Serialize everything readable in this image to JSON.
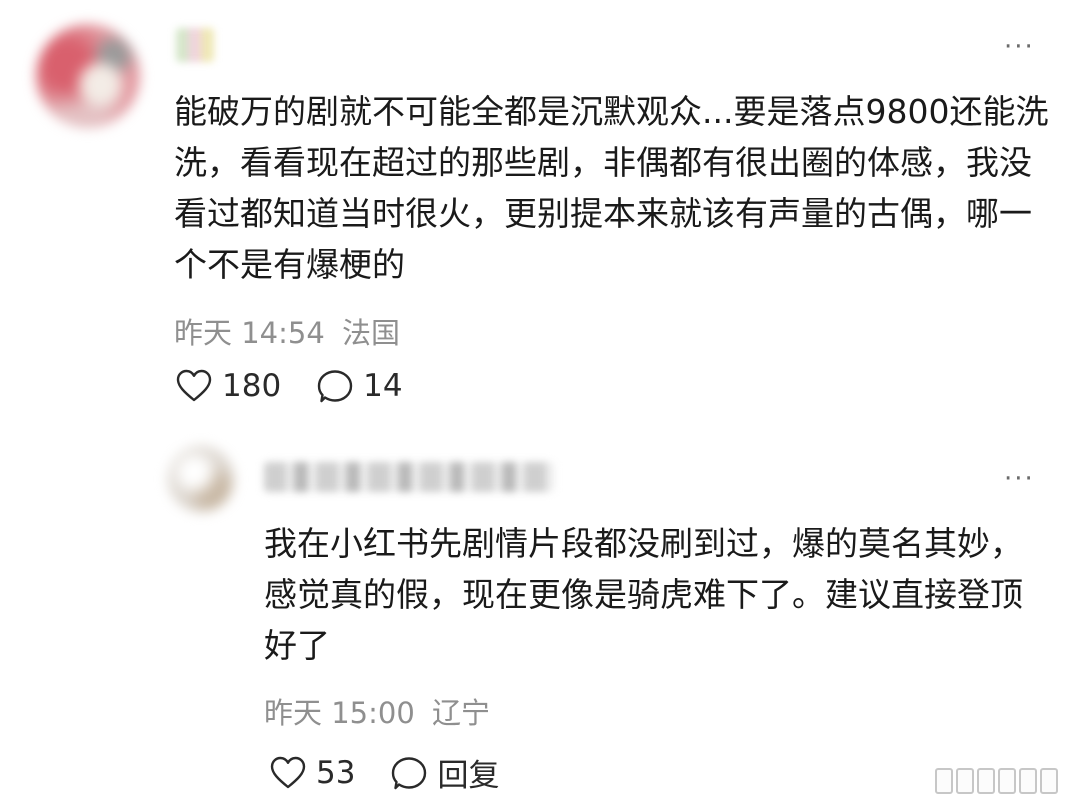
{
  "comment": {
    "text": "能破万的剧就不可能全都是沉默观众...要是落点9800还能洗洗，看看现在超过的那些剧，非偶都有很出圈的体感，我没看过都知道当时很火，更别提本来就该有声量的古偶，哪一个不是有爆梗的",
    "time": "昨天 14:54",
    "location": "法国",
    "likes": "180",
    "replies": "14",
    "more_icon": "more-dots-icon"
  },
  "reply": {
    "text": "我在小红书先剧情片段都没刷到过，爆的莫名其妙，感觉真的假，现在更像是骑虎难下了。建议直接登顶好了",
    "time": "昨天 15:00",
    "location": "辽宁",
    "likes": "53",
    "reply_label": "回复",
    "more_icon": "more-dots-icon"
  },
  "colors": {
    "text": "#1a1a1a",
    "meta": "#8f8f8f",
    "icon": "#2a2a2a"
  }
}
